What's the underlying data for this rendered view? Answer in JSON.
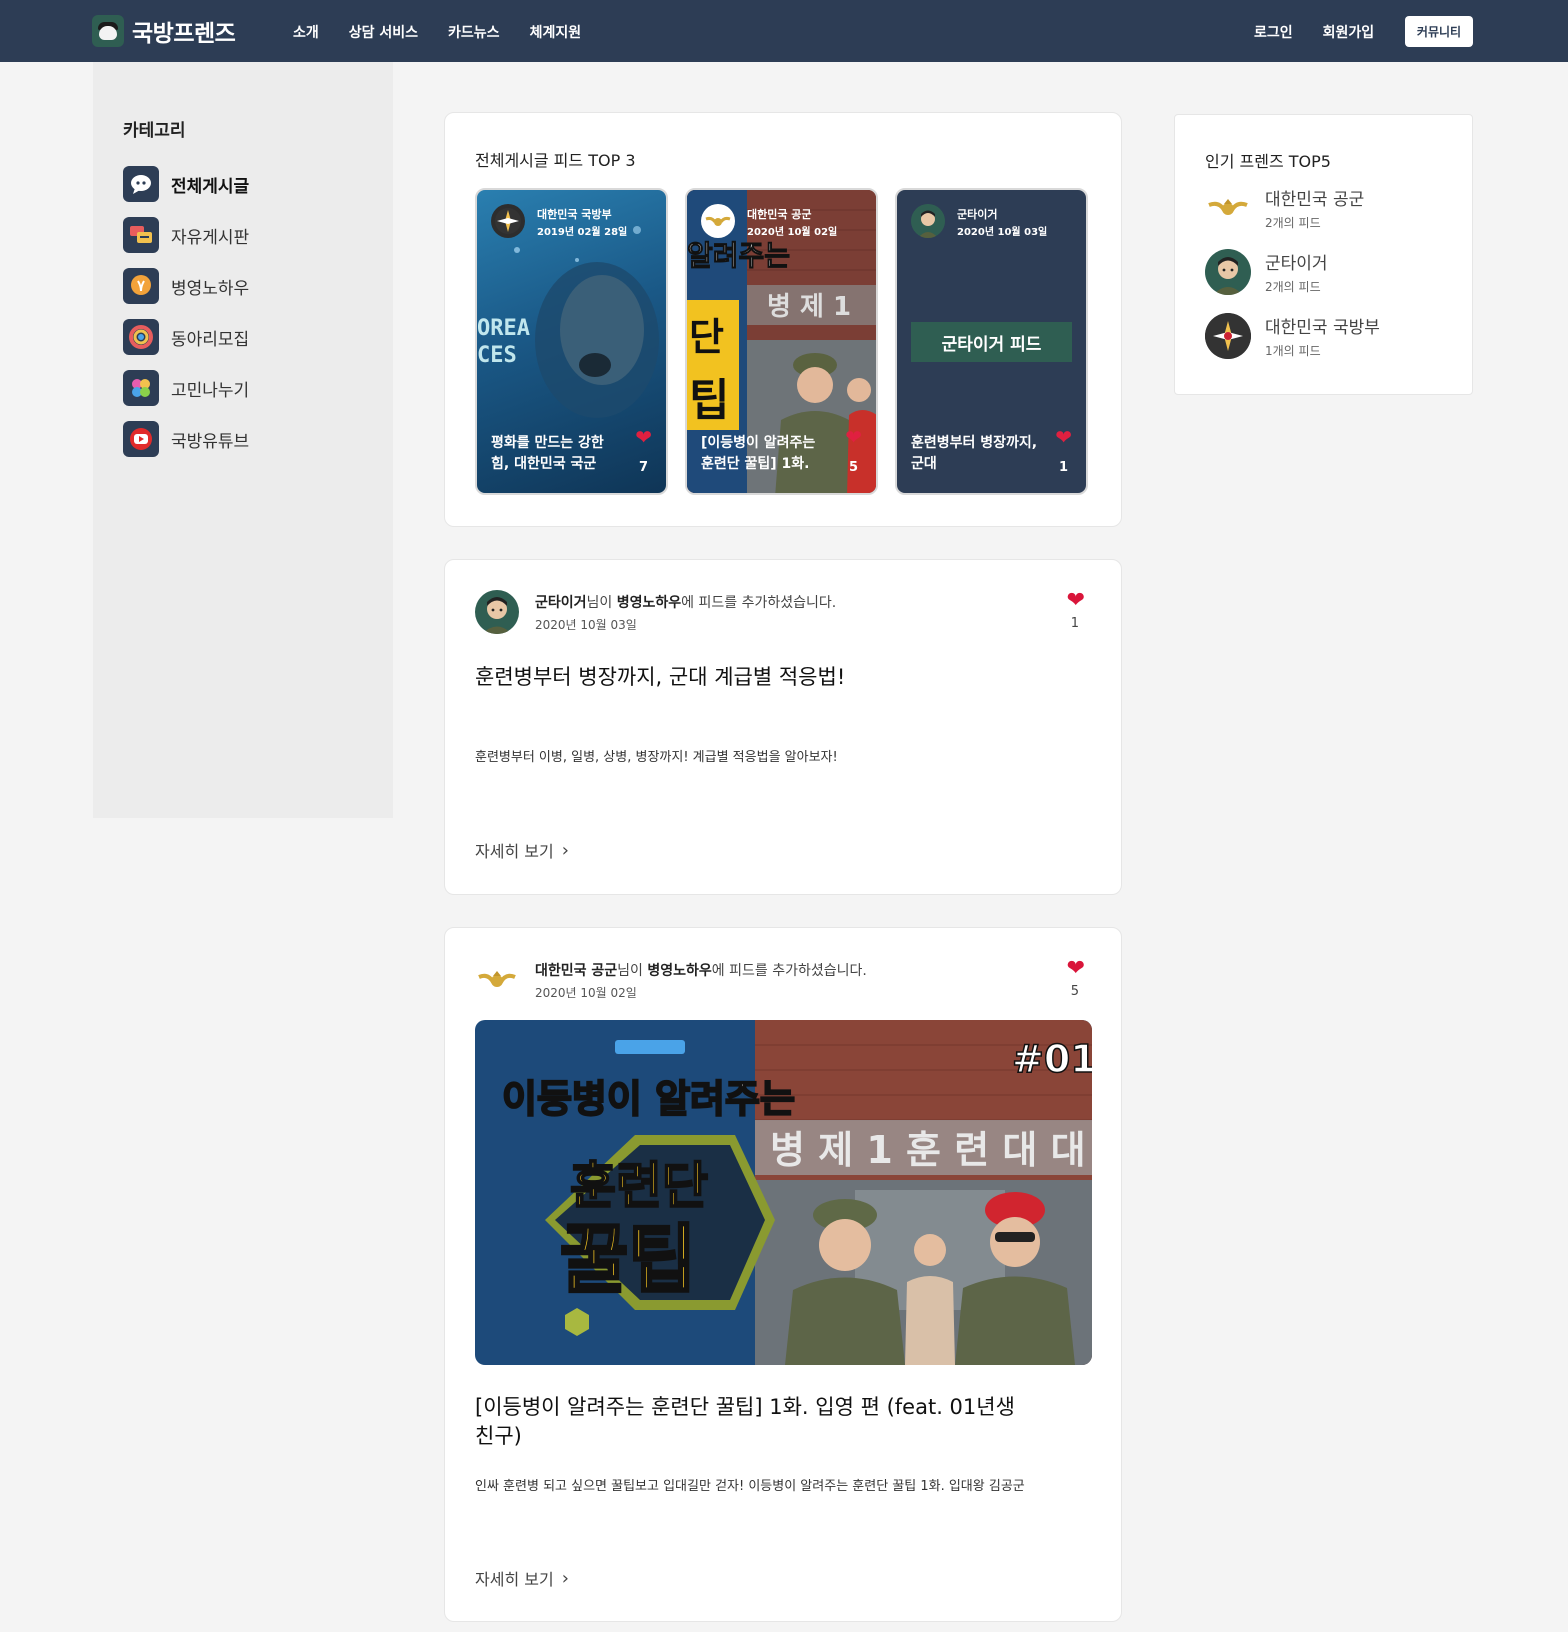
{
  "header": {
    "logo_text": "국방프렌즈",
    "nav": [
      "소개",
      "상담 서비스",
      "카드뉴스",
      "체계지원"
    ],
    "login": "로그인",
    "signup": "회원가입",
    "community": "커뮤니티"
  },
  "sidebar": {
    "title": "카테고리",
    "items": [
      {
        "label": "전체게시글",
        "icon": "chat-icon",
        "color": "#ffffff"
      },
      {
        "label": "자유게시판",
        "icon": "board-icon",
        "color": "#f2c14e"
      },
      {
        "label": "병영노하우",
        "icon": "bulb-icon",
        "color": "#f2a23a"
      },
      {
        "label": "동아리모집",
        "icon": "ring-icon",
        "color": "#e85d5d"
      },
      {
        "label": "고민나누기",
        "icon": "flower-icon",
        "color": "#8ad14a"
      },
      {
        "label": "국방유튜브",
        "icon": "youtube-icon",
        "color": "#e12b2b"
      }
    ]
  },
  "top3": {
    "title": "전체게시글 피드 TOP 3",
    "tiles": [
      {
        "author": "대한민국 국방부",
        "date": "2019년 02월 28일",
        "title": "평화를 만드는 강한 힘, 대한민국 국군",
        "likes": "7"
      },
      {
        "author": "대한민국 공군",
        "date": "2020년 10월 02일",
        "title": "[이등병이 알려주는 훈련단 꿀팁] 1화.",
        "likes": "5"
      },
      {
        "author": "군타이거",
        "date": "2020년 10월 03일",
        "title": "훈련병부터 병장까지, 군대",
        "likes": "1",
        "feed_button": "군타이거 피드"
      }
    ]
  },
  "popular": {
    "title": "인기 프렌즈 TOP5",
    "items": [
      {
        "name": "대한민국 공군",
        "count": "2개의 피드"
      },
      {
        "name": "군타이거",
        "count": "2개의 피드"
      },
      {
        "name": "대한민국 국방부",
        "count": "1개의 피드"
      }
    ]
  },
  "posts": [
    {
      "author": "군타이거",
      "suffix1": "님이 ",
      "category": "병영노하우",
      "suffix2": "에 피드를 추가하셨습니다.",
      "date": "2020년 10월 03일",
      "likes": "1",
      "title": "훈련병부터 병장까지, 군대 계급별 적응법!",
      "body": "훈련병부터 이병, 일병, 상병, 병장까지! 계급별 적응법을 알아보자!",
      "more": "자세히 보기"
    },
    {
      "author": "대한민국 공군",
      "suffix1": "님이 ",
      "category": "병영노하우",
      "suffix2": "에 피드를 추가하셨습니다.",
      "date": "2020년 10월 02일",
      "likes": "5",
      "title": "[이등병이 알려주는 훈련단 꿀팁] 1화. 입영 편 (feat. 01년생 친구)",
      "body": "인싸 훈련병 되고 싶으면 꿀팁보고 입대길만 걷자! 이등병이 알려주는 훈련단 꿀팁 1화. 입대왕 김공군",
      "more": "자세히 보기",
      "thumb": {
        "badge": "#01",
        "line1": "이등병이 알려주는",
        "line2": "훈련단",
        "line3": "꿀팁",
        "sign": "병 제 1 훈 련 대 대"
      }
    }
  ],
  "colors": {
    "navy": "#2d3d55",
    "green": "#2f5e52",
    "heart": "#d9153a"
  }
}
